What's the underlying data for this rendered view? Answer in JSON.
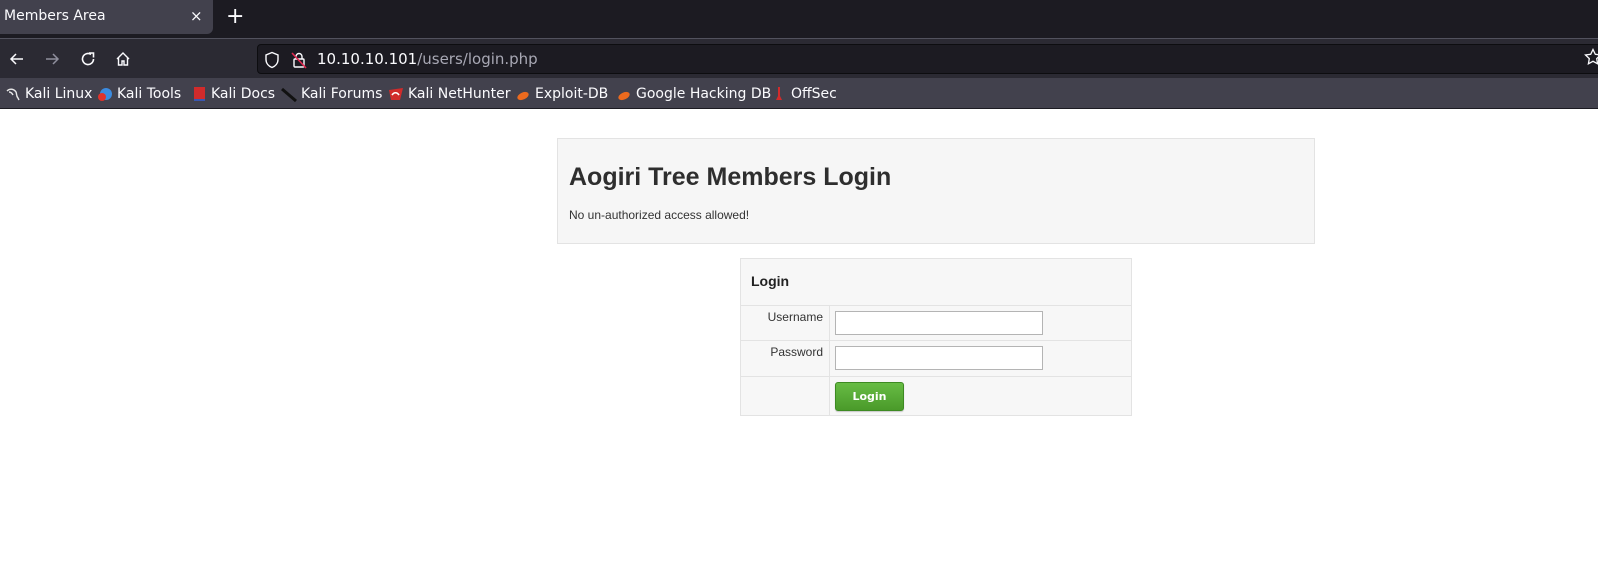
{
  "browser": {
    "tab": {
      "title": "Members Area",
      "close_glyph": "×"
    },
    "new_tab_glyph": "+",
    "nav": {
      "back_icon": "arrow-left-icon",
      "forward_icon": "arrow-right-icon",
      "reload_icon": "reload-icon",
      "home_icon": "home-icon"
    },
    "url": {
      "host": "10.10.10.101",
      "path": "/users/login.php"
    },
    "bookmarks": [
      {
        "label": "Kali Linux",
        "icon": "kali-dragon-icon"
      },
      {
        "label": "Kali Tools",
        "icon": "kali-tools-icon"
      },
      {
        "label": "Kali Docs",
        "icon": "kali-docs-icon"
      },
      {
        "label": "Kali Forums",
        "icon": "kali-forums-icon"
      },
      {
        "label": "Kali NetHunter",
        "icon": "nethunter-icon"
      },
      {
        "label": "Exploit-DB",
        "icon": "exploit-db-icon"
      },
      {
        "label": "Google Hacking DB",
        "icon": "ghdb-icon"
      },
      {
        "label": "OffSec",
        "icon": "offsec-icon"
      }
    ]
  },
  "page": {
    "hero": {
      "title": "Aogiri Tree Members Login",
      "subtitle": "No un-authorized access allowed!"
    },
    "login_form": {
      "heading": "Login",
      "username_label": "Username",
      "username_value": "",
      "password_label": "Password",
      "password_value": "",
      "submit_label": "Login",
      "submit_color": "#5aad37"
    }
  }
}
